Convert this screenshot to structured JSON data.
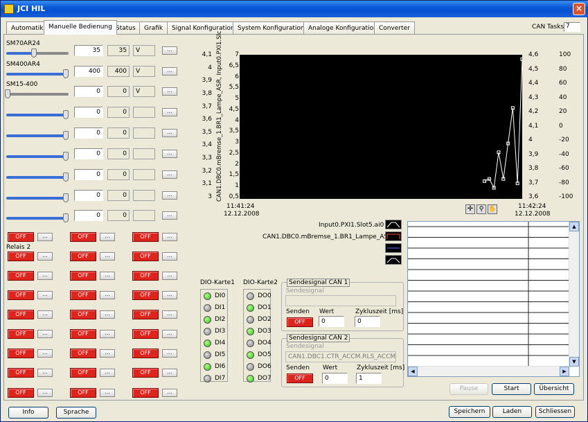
{
  "window": {
    "title": "JCI HIL",
    "close": "×"
  },
  "tabs": [
    "Automatik",
    "Manuelle Bedienung",
    "Status",
    "Grafik",
    "Signal Konfiguration",
    "System Konfiguration",
    "Analoge Konfiguration",
    "Converter"
  ],
  "can_tasks": {
    "label": "CAN Tasks",
    "value": "7"
  },
  "analog_rows": [
    {
      "name": "SM70AR24",
      "set": "35",
      "value": "35",
      "unit": "V",
      "level": 0.45
    },
    {
      "name": "SM400AR4",
      "set": "400",
      "value": "400",
      "unit": "V",
      "level": 1.0
    },
    {
      "name": "SM15-400",
      "set": "0",
      "value": "0",
      "unit": "V",
      "level": 0.0
    },
    {
      "name": "",
      "set": "0",
      "value": "0",
      "unit": "",
      "level": 1.0
    },
    {
      "name": "",
      "set": "0",
      "value": "0",
      "unit": "",
      "level": 1.0
    },
    {
      "name": "",
      "set": "0",
      "value": "0",
      "unit": "",
      "level": 1.0
    },
    {
      "name": "",
      "set": "0",
      "value": "0",
      "unit": "",
      "level": 1.0
    },
    {
      "name": "",
      "set": "0",
      "value": "0",
      "unit": "",
      "level": 1.0
    },
    {
      "name": "",
      "set": "0",
      "value": "0",
      "unit": "",
      "level": 1.0
    }
  ],
  "dots": "...",
  "relais_label": "Relais 2",
  "off_label": "OFF",
  "dio": {
    "card1": {
      "label": "DIO-Karte1",
      "items": [
        {
          "name": "DI0",
          "on": true
        },
        {
          "name": "DI1",
          "on": false
        },
        {
          "name": "DI2",
          "on": true
        },
        {
          "name": "DI3",
          "on": false
        },
        {
          "name": "DI4",
          "on": true
        },
        {
          "name": "DI5",
          "on": false
        },
        {
          "name": "DI6",
          "on": true
        },
        {
          "name": "DI7",
          "on": false
        }
      ]
    },
    "card2": {
      "label": "DIO-Karte2",
      "items": [
        {
          "name": "DO0",
          "on": false
        },
        {
          "name": "DO1",
          "on": true
        },
        {
          "name": "DO2",
          "on": false
        },
        {
          "name": "DO3",
          "on": true
        },
        {
          "name": "DO4",
          "on": false
        },
        {
          "name": "DO5",
          "on": true
        },
        {
          "name": "DO6",
          "on": false
        },
        {
          "name": "DO7",
          "on": true
        }
      ]
    }
  },
  "can1": {
    "title": "Sendesignal CAN 1",
    "signal_label": "Sendesignal",
    "signal": "",
    "senden": "Senden",
    "wert_label": "Wert",
    "wert": "0",
    "zyklus_label": "Zykluszeit [ms]",
    "zyklus": "0"
  },
  "can2": {
    "title": "Sendesignal CAN 2",
    "signal_label": "Sendesignal",
    "signal": "CAN1.DBC1.CTR_ACCM.RLS_ACCM",
    "senden": "Senden",
    "wert_label": "Wert",
    "wert": "0",
    "zyklus_label": "Zykluszeit [ms]",
    "zyklus": "1"
  },
  "chart_labels": {
    "ylabel_left": "CAN1.DBC0.mBremse_1.BR1_Lampe_ASR, Input0.PXI1.Slc",
    "x_start_time": "11:41:24",
    "x_start_date": "12.12.2008",
    "x_end_time": "11:42:24",
    "x_end_date": "12.12.2008",
    "legend1": "Input0.PXI1.Slot5.ai0",
    "legend2": "CAN1.DBC0.mBremse_1.BR1_Lampe_ASR"
  },
  "chart_data": {
    "type": "line",
    "left_axis_outer": {
      "ticks": [
        "4,1",
        "4",
        "3,9",
        "3,8",
        "3,7",
        "3,6",
        "3,5",
        "3,4",
        "3,3",
        "3,2",
        "3,1",
        "3"
      ]
    },
    "left_axis_inner": {
      "ticks": [
        "7",
        "6,5",
        "6",
        "5,5",
        "5",
        "4,5",
        "4",
        "3,5",
        "3",
        "2,5",
        "2",
        "1,5",
        "1",
        "0,5"
      ],
      "ylim": [
        0.5,
        7
      ]
    },
    "right_axis_inner": {
      "ticks": [
        "4,6",
        "4,5",
        "4,4",
        "4,3",
        "4,2",
        "4,1",
        "4",
        "3,9",
        "3,8",
        "3,7",
        "3,6"
      ]
    },
    "right_axis_outer": {
      "ticks": [
        "100",
        "80",
        "60",
        "40",
        "20",
        "0",
        "-20",
        "-40",
        "-60",
        "-80",
        "-100"
      ]
    },
    "xlim_seconds": [
      0,
      60
    ],
    "series": [
      {
        "x": [
          52,
          53,
          54,
          55,
          56,
          57,
          58,
          59,
          60
        ],
        "y": [
          1.3,
          1.4,
          1.0,
          2.6,
          1.4,
          3.0,
          4.6,
          1.2,
          6.8
        ]
      }
    ]
  },
  "scroll_list": {
    "up": "▲",
    "down": "▼",
    "left": "◀",
    "right": "▶"
  },
  "buttons": {
    "pause": "Pause",
    "start": "Start",
    "uebersicht": "Übersicht",
    "info": "Info",
    "sprache": "Sprache",
    "speichern": "Speichern",
    "laden": "Laden",
    "schliessen": "Schliessen"
  }
}
